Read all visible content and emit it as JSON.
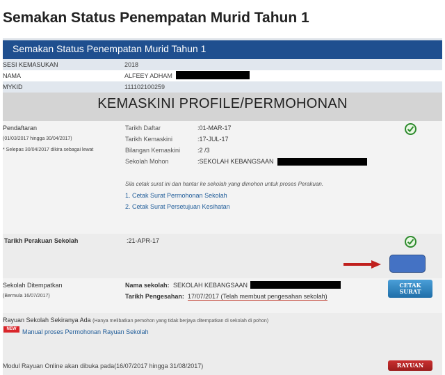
{
  "page_title": "Semakan Status Penempatan Murid Tahun 1",
  "header_title": "Semakan Status Penempatan Murid Tahun 1",
  "info": [
    {
      "key": "SESI KEMASUKAN",
      "value": "2018"
    },
    {
      "key": "NAMA",
      "value": "ALFEEY ADHAM"
    },
    {
      "key": "MYKID",
      "value": "111102100259"
    }
  ],
  "band_title": "KEMASKINI PROFILE/PERMOHONAN",
  "pendaftaran": {
    "title": "Pendaftaran",
    "period": "(01/03/2017 hingga 30/04/2017)",
    "note": "* Selepas 30/04/2017 dikira sebagai lewat",
    "rows": [
      {
        "label": "Tarikh Daftar",
        "value": ":01-MAR-17"
      },
      {
        "label": "Tarikh Kemaskini",
        "value": ":17-JUL-17"
      },
      {
        "label": "Bilangan Kemaskini",
        "value": ":2 /3"
      },
      {
        "label": "Sekolah Mohon",
        "value": ":SEKOLAH KEBANGSAAN"
      }
    ],
    "instruction": "Sila cetak surat ini dan hantar ke sekolah yang dimohon untuk proses Perakuan.",
    "links": [
      "1. Cetak Surat Permohonan Sekolah",
      "2. Cetak Surat Persetujuan Kesihatan"
    ]
  },
  "perakuan": {
    "label": "Tarikh Perakuan Sekolah",
    "value": ":21-APR-17"
  },
  "ditempatkan": {
    "title": "Sekolah Ditempatkan",
    "sub": "(Bermula 16/07/2017)",
    "nama_label": "Nama sekolah:",
    "nama_value": "SEKOLAH KEBANGSAAN",
    "pengesahan_label": "Tarikh Pengesahan:",
    "pengesahan_value": "17/07/2017 (Telah membuat pengesahan sekolah)",
    "cetak_line1": "CETAK",
    "cetak_line2": "SURAT"
  },
  "rayuan": {
    "title": "Rayuan Sekolah Sekiranya Ada",
    "title_note": "(Hanya melibatkan pemohon yang tidak berjaya ditempatkan di sekolah di pohon)",
    "new_badge": "NEW",
    "manual_link": "Manual proses Permohonan Rayuan Sekolah",
    "modul_text": "Modul Rayuan Online akan dibuka pada(16/07/2017 hingga 31/08/2017)",
    "button": "RAYUAN"
  },
  "colors": {
    "header_blue": "#1f4f8f",
    "check_green": "#2e8b2e",
    "arrow_red": "#c0201e",
    "rayuan_red": "#b22424"
  }
}
